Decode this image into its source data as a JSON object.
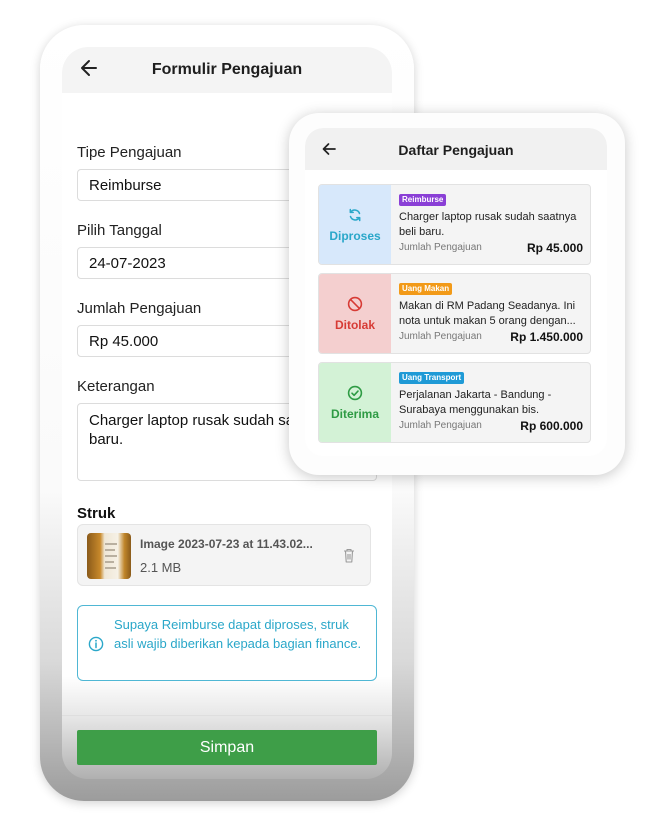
{
  "form": {
    "title": "Formulir Pengajuan",
    "fields": {
      "type_label": "Tipe Pengajuan",
      "type_value": "Reimburse",
      "date_label": "Pilih Tanggal",
      "date_value": "24-07-2023",
      "amount_label": "Jumlah Pengajuan",
      "amount_value": "Rp 45.000",
      "note_label": "Keterangan",
      "note_value": "Charger laptop rusak sudah saatnya beli baru."
    },
    "receipt": {
      "label": "Struk",
      "file_name": "Image 2023-07-23 at 11.43.02...",
      "file_size": "2.1 MB"
    },
    "info_text": "Supaya Reimburse dapat diproses, struk asli wajib diberikan kepada bagian finance.",
    "save_label": "Simpan"
  },
  "list": {
    "title": "Daftar Pengajuan",
    "amount_label": "Jumlah Pengajuan",
    "items": [
      {
        "status": "Diproses",
        "category": "Reimburse",
        "description": "Charger laptop rusak sudah saatnya beli baru.",
        "amount": "Rp 45.000"
      },
      {
        "status": "Ditolak",
        "category": "Uang Makan",
        "description": "Makan di RM Padang Seadanya. Ini nota untuk makan 5 orang dengan...",
        "amount": "Rp 1.450.000"
      },
      {
        "status": "Diterima",
        "category": "Uang Transport",
        "description": "Perjalanan Jakarta - Bandung - Surabaya menggunakan bis.",
        "amount": "Rp 600.000"
      }
    ]
  },
  "icons": {
    "back": "arrow-left-icon",
    "trash": "trash-icon",
    "info": "info-circle-icon",
    "processing": "refresh-icon",
    "rejected": "block-icon",
    "accepted": "check-circle-icon"
  },
  "colors": {
    "primary_green": "#3e9e48",
    "info_blue": "#2aa7c9",
    "processing": "#2aa7c9",
    "processing_bg": "#d7e8fb",
    "rejected": "#d73b35",
    "rejected_bg": "#f4cfcf",
    "accepted": "#2e9b44",
    "accepted_bg": "#d3f2d6",
    "badge_reimburse": "#8a3fd6",
    "badge_makan": "#f29a18",
    "badge_transport": "#1f9ad6"
  }
}
